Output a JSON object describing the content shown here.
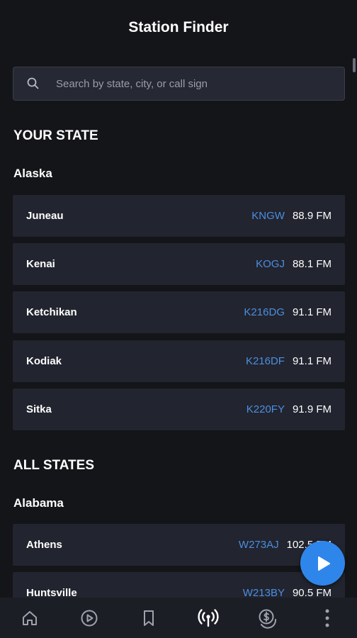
{
  "header": {
    "title": "Station Finder"
  },
  "search": {
    "placeholder": "Search by state, city, or call sign"
  },
  "your_state": {
    "heading": "YOUR STATE",
    "state": "Alaska",
    "stations": [
      {
        "city": "Juneau",
        "call_sign": "KNGW",
        "frequency": "88.9 FM"
      },
      {
        "city": "Kenai",
        "call_sign": "KOGJ",
        "frequency": "88.1 FM"
      },
      {
        "city": "Ketchikan",
        "call_sign": "K216DG",
        "frequency": "91.1 FM"
      },
      {
        "city": "Kodiak",
        "call_sign": "K216DF",
        "frequency": "91.1 FM"
      },
      {
        "city": "Sitka",
        "call_sign": "K220FY",
        "frequency": "91.9 FM"
      }
    ]
  },
  "all_states": {
    "heading": "ALL STATES",
    "state": "Alabama",
    "stations": [
      {
        "city": "Athens",
        "call_sign": "W273AJ",
        "frequency": "102.5 FM"
      },
      {
        "city": "Huntsville",
        "call_sign": "W213BY",
        "frequency": "90.5 FM"
      }
    ]
  },
  "bottom_nav": {
    "items": [
      {
        "icon": "home-icon",
        "active": false
      },
      {
        "icon": "play-circle-icon",
        "active": false
      },
      {
        "icon": "bookmark-icon",
        "active": false
      },
      {
        "icon": "radio-tower-icon",
        "active": true
      },
      {
        "icon": "donate-icon",
        "active": false
      },
      {
        "icon": "more-vertical-icon",
        "active": false
      }
    ]
  },
  "colors": {
    "background": "#141519",
    "row_background": "#22242f",
    "call_sign": "#4a8fe0",
    "fab": "#2f86ea"
  }
}
